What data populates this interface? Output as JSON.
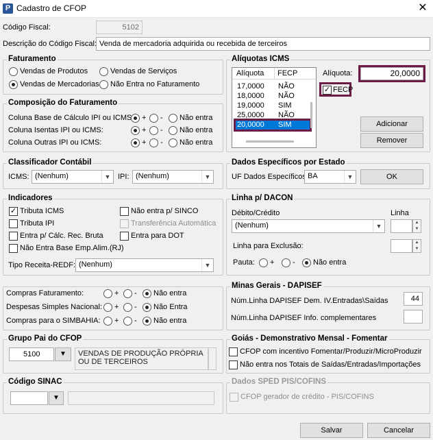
{
  "window": {
    "title": "Cadastro de CFOP",
    "app_icon": "P"
  },
  "codigo_fiscal": {
    "label": "Código Fiscal:",
    "value": "5102"
  },
  "descricao": {
    "label": "Descrição do Código Fiscal:",
    "value": "Venda de mercadoria adquirida ou recebida de terceiros"
  },
  "faturamento": {
    "title": "Faturamento",
    "options": [
      "Vendas de Produtos",
      "Vendas de Serviços",
      "Vendas de Mercadorias",
      "Não Entra no Faturamento"
    ],
    "selected": "Vendas de Mercadorias"
  },
  "composicao": {
    "title": "Composição do Faturamento",
    "rows": [
      {
        "label": "Coluna Base de Cálculo IPI ou ICMS:",
        "selected": "+"
      },
      {
        "label": "Coluna Isentas IPI ou ICMS:",
        "selected": "+"
      },
      {
        "label": "Coluna Outras IPI ou ICMS:",
        "selected": "+"
      }
    ],
    "plus": "+",
    "minus": "-",
    "none": "Não entra"
  },
  "aliquotas": {
    "title": "Alíquotas ICMS",
    "col_aliquota": "Alíquota",
    "col_fecp": "FECP",
    "rows": [
      [
        "17,0000",
        "NÃO"
      ],
      [
        "18,0000",
        "NÃO"
      ],
      [
        "19,0000",
        "SIM"
      ],
      [
        "25,0000",
        "NÃO"
      ],
      [
        "20,0000",
        "SIM"
      ]
    ],
    "selected_row": 4,
    "aliquota_label": "Alíquota:",
    "aliquota_value": "20,0000",
    "fecp_label": "FECP",
    "fecp_checked": true,
    "adicionar": "Adicionar",
    "remover": "Remover"
  },
  "classificador": {
    "title": "Classificador Contábil",
    "icms_label": "ICMS:",
    "icms_value": "(Nenhum)",
    "ipi_label": "IPI:",
    "ipi_value": "(Nenhum)"
  },
  "dados_estado": {
    "title": "Dados Específicos por Estado",
    "uf_label": "UF Dados Específicos:",
    "uf_value": "BA",
    "ok": "OK"
  },
  "indicadores": {
    "title": "Indicadores",
    "tributa_icms": "Tributa ICMS",
    "tributa_ipi": "Tributa IPI",
    "entra_calc": "Entra p/ Cálc. Rec. Bruta",
    "nao_entra_base": "Não Entra Base Emp.Alim.(RJ)",
    "nao_entra_sinco": "Não entra p/ SINCO",
    "transferencia": "Transferência Automática",
    "entra_dot": "Entra para DOT",
    "tipo_receita_label": "Tipo Receita-REDF:",
    "tipo_receita_value": "(Nenhum)"
  },
  "linha_dacon": {
    "title": "Linha p/ DACON",
    "debito_label": "Débito/Crédito",
    "linha_label": "Linha",
    "debito_value": "(Nenhum)",
    "exclusao_label": "Linha para Exclusão:",
    "pauta_label": "Pauta:",
    "plus": "+",
    "minus": "-",
    "none": "Não entra"
  },
  "compras": {
    "rows": [
      {
        "label": "Compras Faturamento:",
        "none": "Não entra"
      },
      {
        "label": "Despesas Simples Nacional:",
        "none": "Não Entra"
      },
      {
        "label": "Compras para o SIMBAHIA:",
        "none": "Não entra"
      }
    ],
    "plus": "+",
    "minus": "-"
  },
  "minas": {
    "title": "Minas Gerais - DAPISEF",
    "dem_label": "Núm.Linha DAPISEF Dem. IV.Entradas\\Saídas",
    "dem_value": "44",
    "info_label": "Núm.Linha DAPISEF Info. complementares"
  },
  "grupo_pai": {
    "title": "Grupo Pai do CFOP",
    "code": "5100",
    "description": "VENDAS DE PRODUÇÃO PRÓPRIA OU DE TERCEIROS"
  },
  "goias": {
    "title": "Goiás - Demonstrativo Mensal - Fomentar",
    "opt1": "CFOP com incentivo  Fomentar/Produzir/MicroProduzir",
    "opt2": "Não entra nos Totais de  Saídas/Entradas/Importações"
  },
  "sinac": {
    "title": "Código SINAC"
  },
  "sped": {
    "title": "Dados SPED PIS/COFINS",
    "opt": "CFOP gerador de crédito - PIS/COFINS"
  },
  "footer": {
    "salvar": "Salvar",
    "cancelar": "Cancelar"
  }
}
